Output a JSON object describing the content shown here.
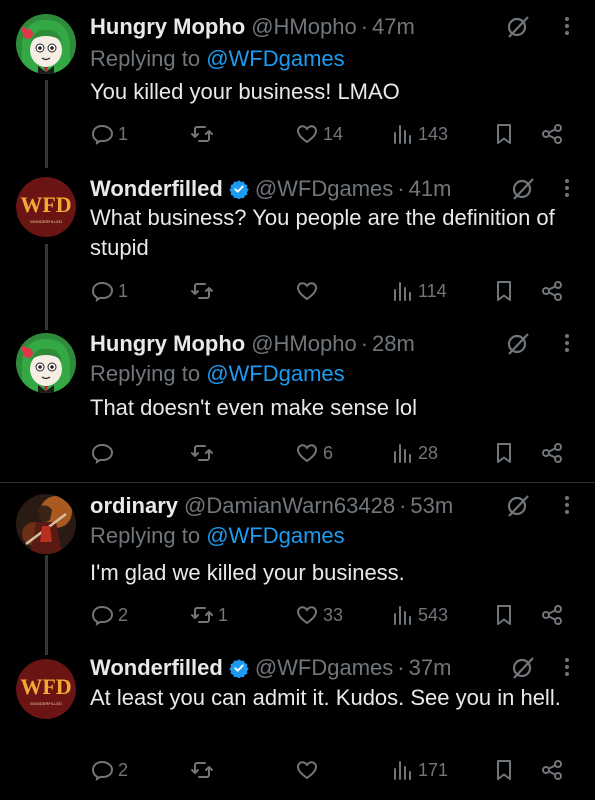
{
  "colors": {
    "background": "#000000",
    "text": "#e7e9ea",
    "muted": "#71767b",
    "link": "#1d9bf0",
    "verified": "#1d9bf0"
  },
  "tweets": [
    {
      "author": "Hungry Mopho",
      "handle": "@HMopho",
      "dot": "·",
      "time": "47m",
      "replying_prefix": "Replying to",
      "replying_to": "@WFDgames",
      "text": "You killed your business! LMAO",
      "replies": "1",
      "reposts": "",
      "likes": "14",
      "views": "143",
      "avatar": "anime-girl-avatar"
    },
    {
      "author": "Wonderfilled",
      "handle": "@WFDgames",
      "dot": "·",
      "time": "41m",
      "text": "What business? You people are the definition of stupid",
      "replies": "1",
      "reposts": "",
      "likes": "",
      "views": "114",
      "avatar": "wfd-logo-avatar"
    },
    {
      "author": "Hungry Mopho",
      "handle": "@HMopho",
      "dot": "·",
      "time": "28m",
      "replying_prefix": "Replying to",
      "replying_to": "@WFDgames",
      "text": "That doesn't even make sense lol",
      "replies": "",
      "reposts": "",
      "likes": "6",
      "views": "28",
      "avatar": "anime-girl-avatar"
    },
    {
      "author": "ordinary",
      "handle": "@DamianWarn63428",
      "dot": "·",
      "time": "53m",
      "replying_prefix": "Replying to",
      "replying_to": "@WFDgames",
      "text": "I'm glad we killed your business.",
      "replies": "2",
      "reposts": "1",
      "likes": "33",
      "views": "543",
      "avatar": "warrior-avatar"
    },
    {
      "author": "Wonderfilled",
      "handle": "@WFDgames",
      "dot": "·",
      "time": "37m",
      "text": "At least you can admit it. Kudos. See you in hell.",
      "replies": "2",
      "reposts": "",
      "likes": "",
      "views": "171",
      "avatar": "wfd-logo-avatar"
    }
  ],
  "logo_text": "WFD",
  "logo_subtext": "WONDERFILLED"
}
